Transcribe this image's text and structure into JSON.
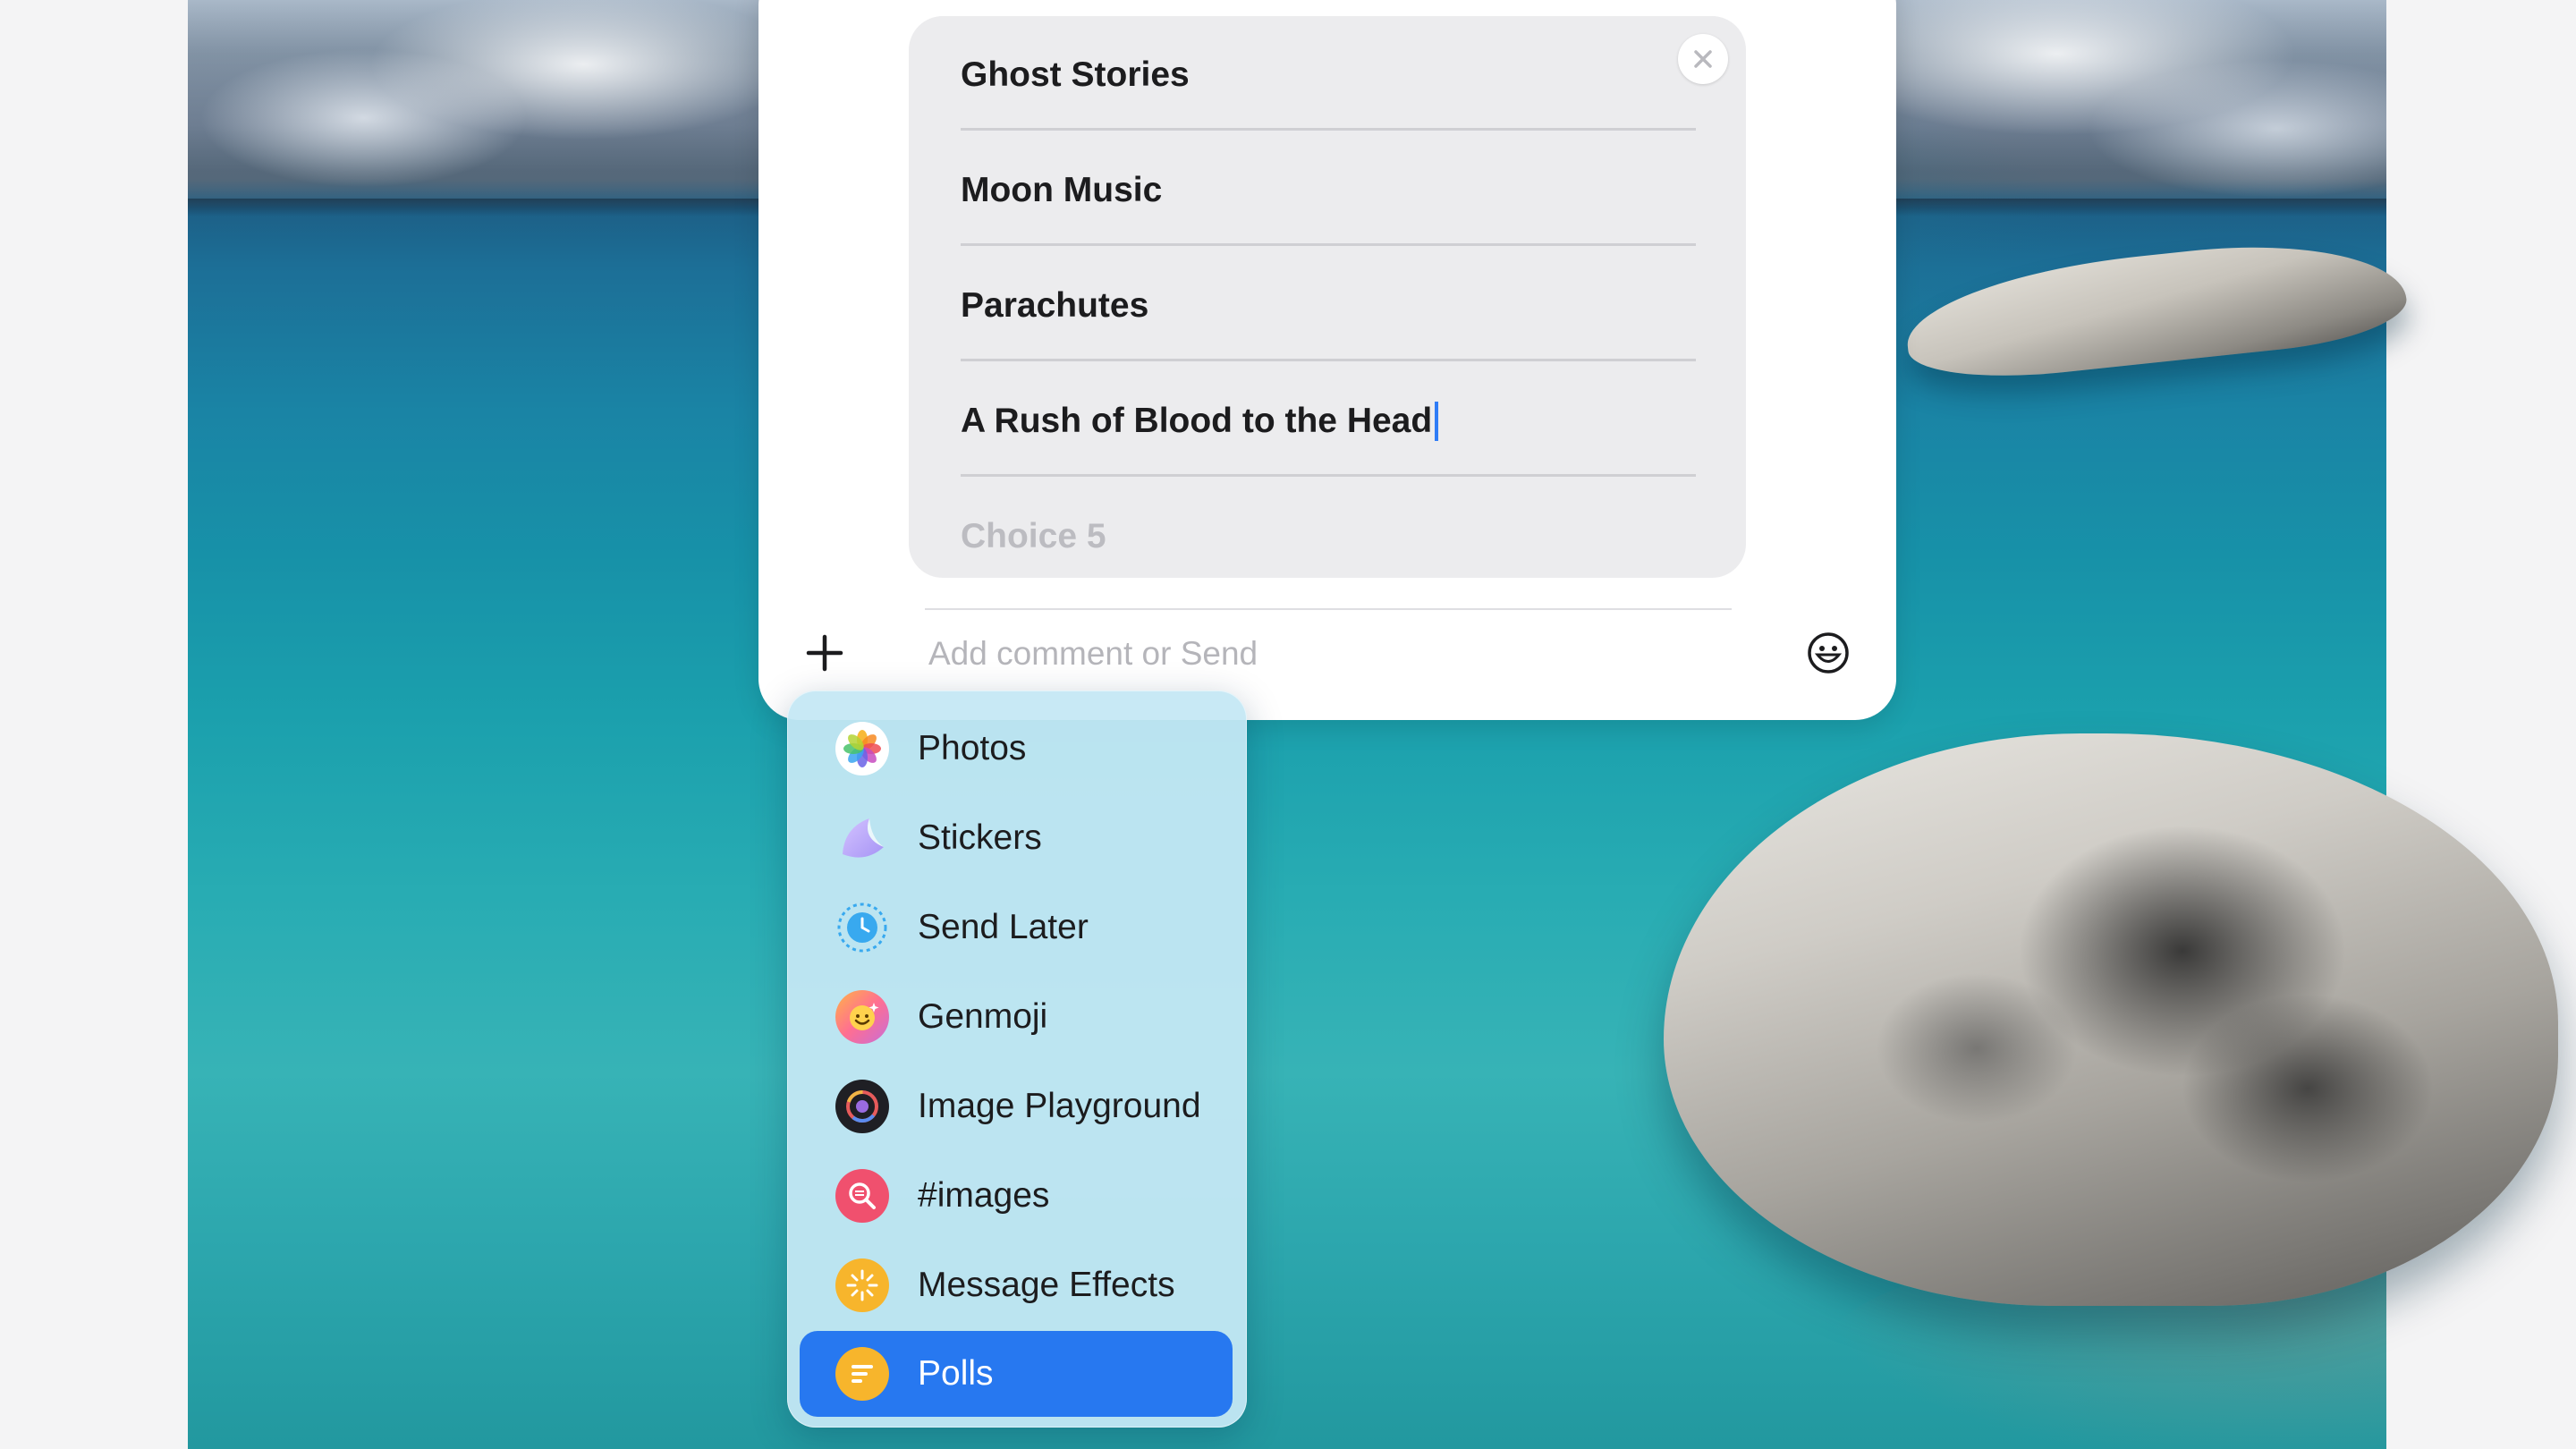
{
  "poll": {
    "choices": [
      {
        "text": "Ghost Stories"
      },
      {
        "text": "Moon Music"
      },
      {
        "text": "Parachutes"
      },
      {
        "text": "A Rush of Blood to the Head"
      }
    ],
    "next_choice_placeholder": "Choice 5"
  },
  "composer": {
    "comment_placeholder": "Add comment or Send"
  },
  "menu": {
    "items": [
      {
        "label": "Photos",
        "icon": "photos-icon"
      },
      {
        "label": "Stickers",
        "icon": "stickers-icon"
      },
      {
        "label": "Send Later",
        "icon": "send-later-icon"
      },
      {
        "label": "Genmoji",
        "icon": "genmoji-icon"
      },
      {
        "label": "Image Playground",
        "icon": "image-playground-icon"
      },
      {
        "label": "#images",
        "icon": "images-search-icon"
      },
      {
        "label": "Message Effects",
        "icon": "message-effects-icon"
      },
      {
        "label": "Polls",
        "icon": "polls-icon",
        "selected": true
      }
    ]
  },
  "colors": {
    "accent": "#2778f0",
    "caret": "#2f7cf6",
    "menu_background": "#c5e8f4"
  }
}
